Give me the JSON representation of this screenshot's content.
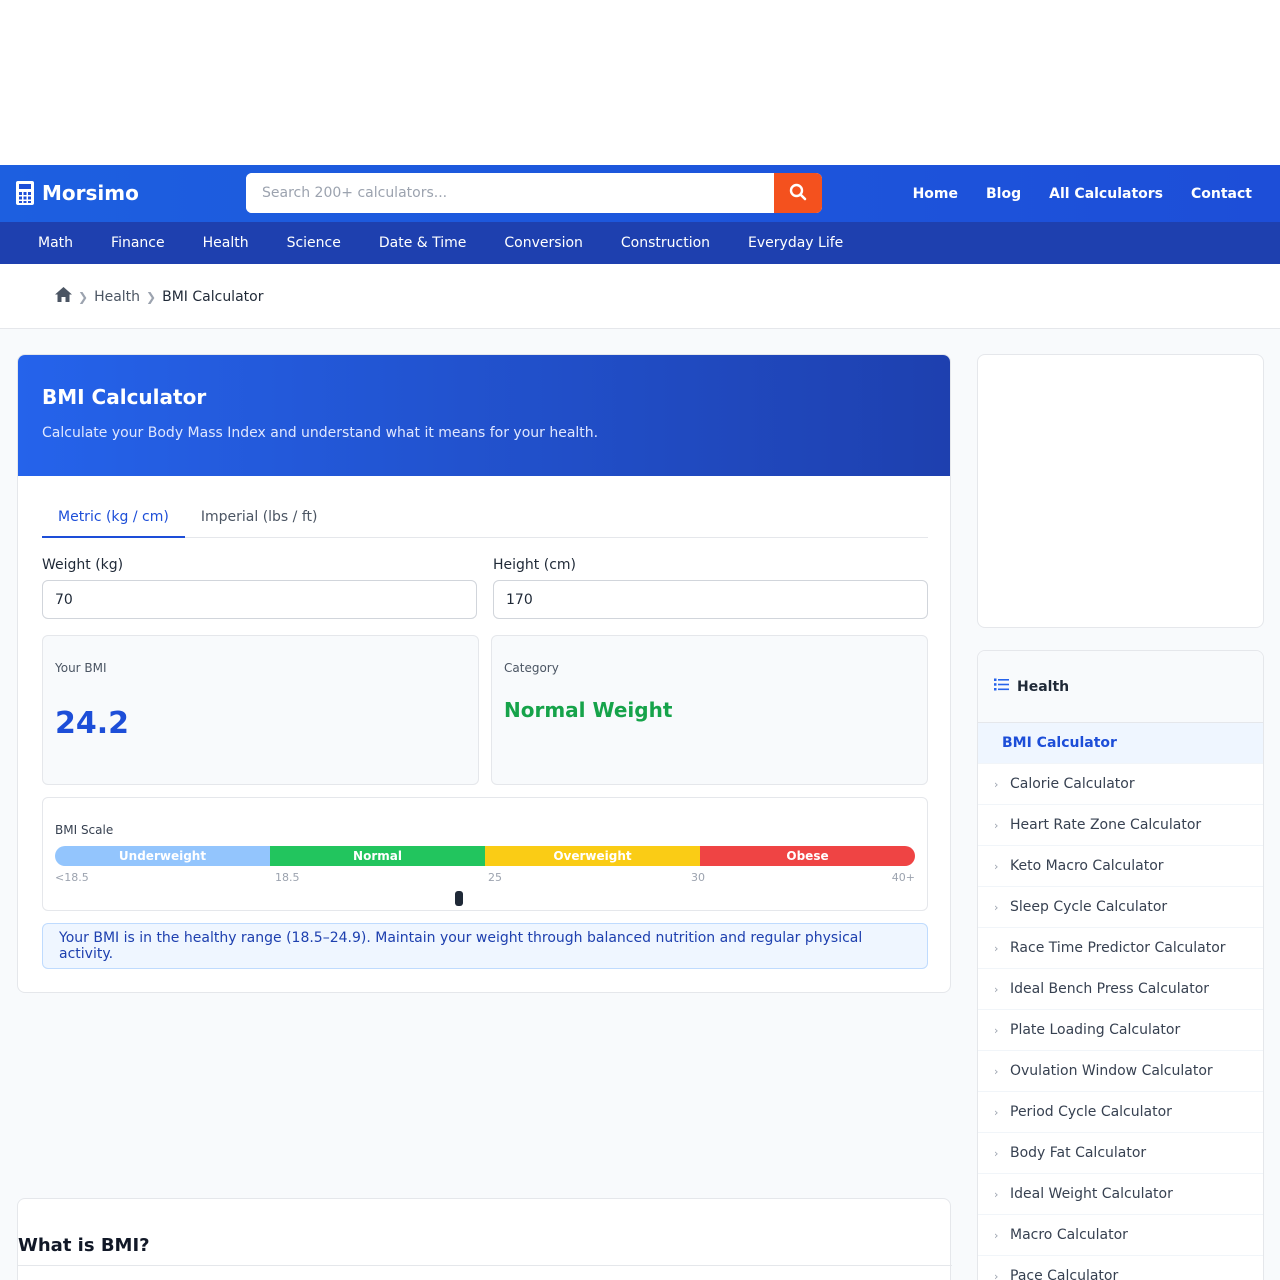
{
  "header": {
    "logo_text": "Morsimo",
    "search_placeholder": "Search 200+ calculators...",
    "nav": [
      "Home",
      "Blog",
      "All Calculators",
      "Contact"
    ]
  },
  "categories": [
    "Math",
    "Finance",
    "Health",
    "Science",
    "Date & Time",
    "Conversion",
    "Construction",
    "Everyday Life"
  ],
  "breadcrumb": {
    "parent": "Health",
    "current": "BMI Calculator"
  },
  "calculator": {
    "title": "BMI Calculator",
    "subtitle": "Calculate your Body Mass Index and understand what it means for your health.",
    "tabs": [
      "Metric (kg / cm)",
      "Imperial (lbs / ft)"
    ],
    "active_tab": 0,
    "weight_label": "Weight (kg)",
    "weight_value": "70",
    "height_label": "Height (cm)",
    "height_value": "170",
    "bmi_label": "Your BMI",
    "bmi_value": "24.2",
    "category_label": "Category",
    "category_value": "Normal Weight",
    "scale": {
      "title": "BMI Scale",
      "segments": [
        {
          "label": "Underweight",
          "color": "#93c5fd"
        },
        {
          "label": "Normal",
          "color": "#22c55e"
        },
        {
          "label": "Overweight",
          "color": "#facc15"
        },
        {
          "label": "Obese",
          "color": "#ef4444"
        }
      ],
      "ticks": [
        "<18.5",
        "18.5",
        "25",
        "30",
        "40+"
      ],
      "marker_value": 24.2
    },
    "advice": "Your BMI is in the healthy range (18.5–24.9). Maintain your weight through balanced nutrition and regular physical activity."
  },
  "what_heading": "What is BMI?",
  "sidebar": {
    "heading": "Health",
    "items": [
      "BMI Calculator",
      "Calorie Calculator",
      "Heart Rate Zone Calculator",
      "Keto Macro Calculator",
      "Sleep Cycle Calculator",
      "Race Time Predictor Calculator",
      "Ideal Bench Press Calculator",
      "Plate Loading Calculator",
      "Ovulation Window Calculator",
      "Period Cycle Calculator",
      "Body Fat Calculator",
      "Ideal Weight Calculator",
      "Macro Calculator",
      "Pace Calculator"
    ]
  }
}
